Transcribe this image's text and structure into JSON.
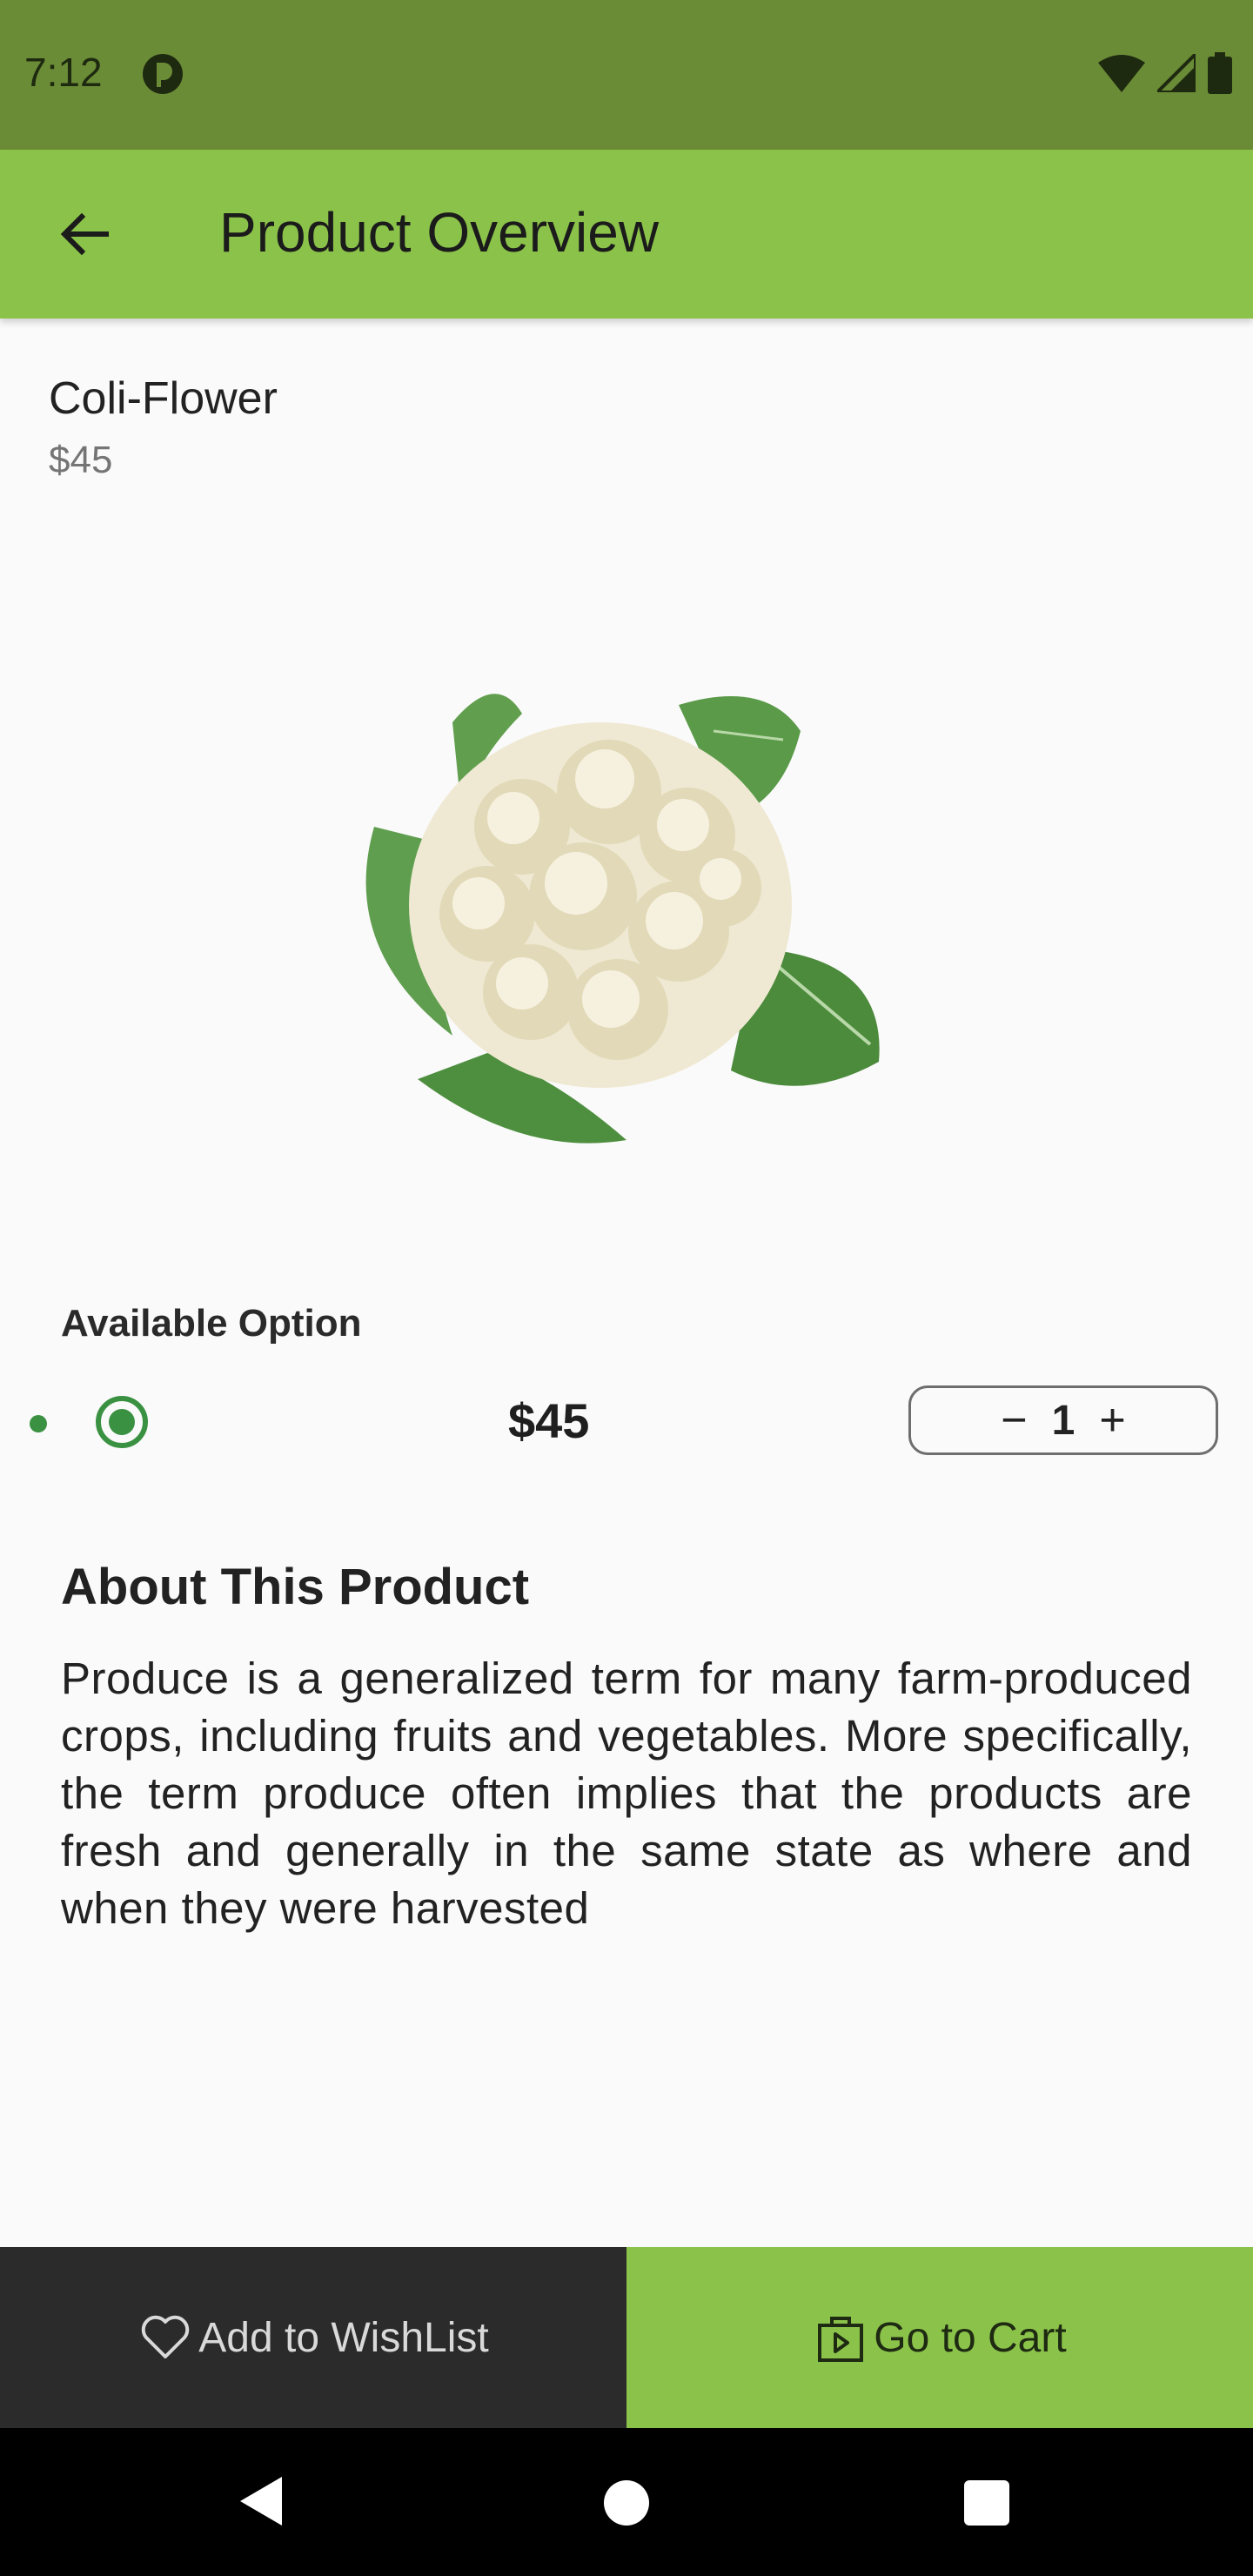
{
  "status_bar": {
    "time": "7:12"
  },
  "app_bar": {
    "title": "Product Overview"
  },
  "product": {
    "name": "Coli-Flower",
    "price": "$45",
    "image_icon": "cauliflower-image"
  },
  "options": {
    "label": "Available Option",
    "selected_price": "$45",
    "quantity": "1",
    "minus": "−",
    "plus": "+"
  },
  "about": {
    "title": "About This Product",
    "text": "Produce is a generalized term for many farm-produced crops, including fruits and vegetables. More specifically, the term produce often implies that the products are fresh and generally in the same state as where and when they were harvested"
  },
  "actions": {
    "wishlist_label": "Add to WishList",
    "cart_label": "Go to Cart"
  },
  "colors": {
    "primary": "#8bc34a",
    "status_bar": "#6b8c36",
    "accent_green": "#3a9142",
    "dark_button": "#2b2b2b"
  }
}
